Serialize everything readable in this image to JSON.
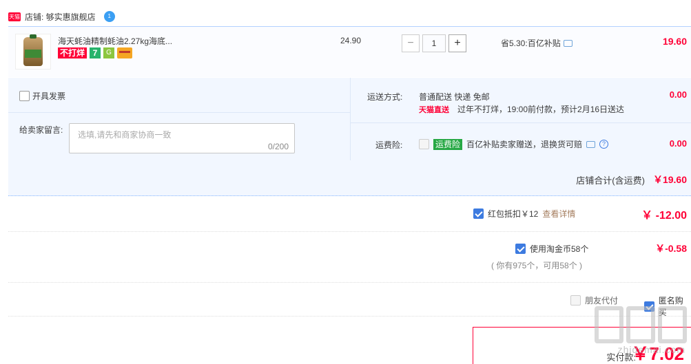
{
  "store": {
    "logo_text": "天猫",
    "name_label": "店铺: 够实惠旗舰店",
    "wangwang_text": "1"
  },
  "item": {
    "title": "海天蚝油精制蚝油2.27kg海底...",
    "badge_no_close": "不打烊",
    "badge_seven": "7",
    "badge_g": "G",
    "unit_price": "24.90",
    "quantity": "1",
    "minus_label": "−",
    "plus_label": "+",
    "discount_text": "省5.30:百亿补贴",
    "subtotal": "19.60"
  },
  "invoice": {
    "label": "开具发票"
  },
  "message": {
    "label": "给卖家留言:",
    "placeholder": "选填,请先和商家协商一致",
    "count": "0/200"
  },
  "shipping": {
    "label": "运送方式:",
    "value": "普通配送 快递 免邮",
    "direct_logo": "天猫直送",
    "direct_note": "过年不打烊，19:00前付款，预计2月16日送达",
    "fee": "0.00"
  },
  "insurance": {
    "label": "运费险:",
    "badge": "运费险",
    "text": "百亿补贴卖家赠送，退换货可赔",
    "fee": "0.00",
    "question_mark": "?"
  },
  "store_total": {
    "label": "店铺合计(含运费)",
    "value": "￥19.60"
  },
  "red_packet": {
    "label": "红包抵扣￥12",
    "link": "查看详情",
    "value": "￥ -12.00",
    "checked": true
  },
  "taobao_coin": {
    "label": "使用淘金币58个",
    "note": "( 你有975个，可用58个 )",
    "value": "￥-0.58",
    "checked": true
  },
  "friend_pay": {
    "label": "朋友代付",
    "checked": false
  },
  "anonymous": {
    "label": "匿名购买",
    "checked": true
  },
  "payment": {
    "label": "实付款:",
    "amount": "￥7.02"
  },
  "watermark": {
    "url": "zhidemai.com"
  },
  "colors": {
    "accent_red": "#ff0036",
    "border_blue": "#b2d1ff",
    "bg_blue": "#f2f7ff",
    "checkbox_blue": "#3d7be0"
  }
}
